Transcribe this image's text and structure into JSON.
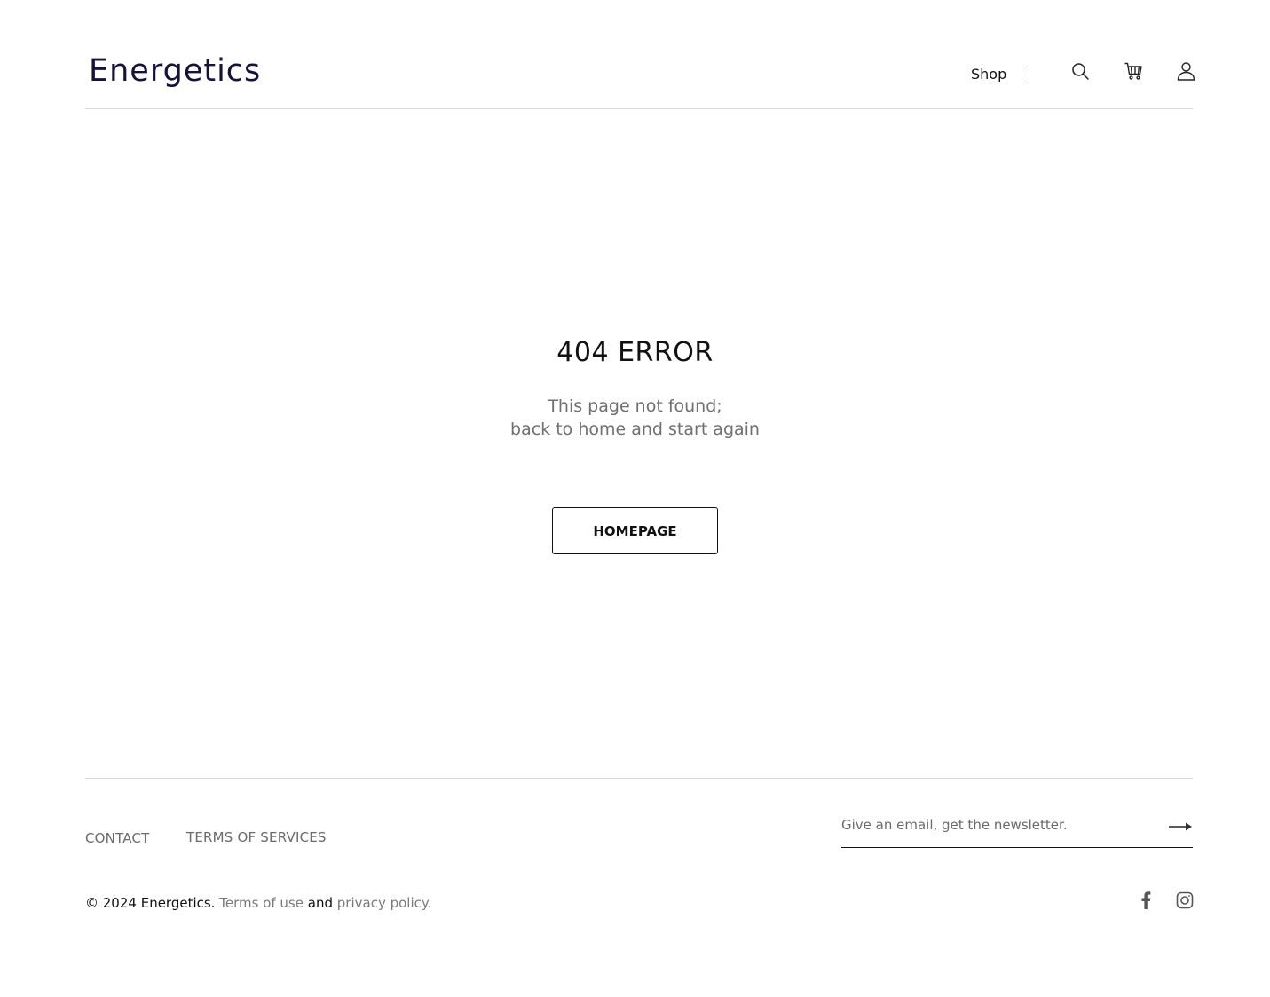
{
  "header": {
    "logo": "Energetics",
    "nav_shop": "Shop",
    "icons": [
      "search-icon",
      "cart-icon",
      "user-icon"
    ]
  },
  "main": {
    "title": "404 ERROR",
    "message_line1": "This page not found;",
    "message_line2": "back to home and start again",
    "button_label": "HOMEPAGE"
  },
  "footer": {
    "links": {
      "contact": "CONTACT",
      "terms": "TERMS OF SERVICES"
    },
    "newsletter": {
      "placeholder": "Give an email, get the newsletter.",
      "value": ""
    },
    "copyright": {
      "prefix": "© 2024 Energetics.",
      "terms_link": "Terms of use",
      "and": "and",
      "privacy_link": "privacy policy."
    },
    "social": [
      "facebook-icon",
      "instagram-icon"
    ]
  },
  "colors": {
    "logo": "#17123a",
    "text": "#111111",
    "muted": "#6f6f6f",
    "divider": "#dcdcdc"
  }
}
